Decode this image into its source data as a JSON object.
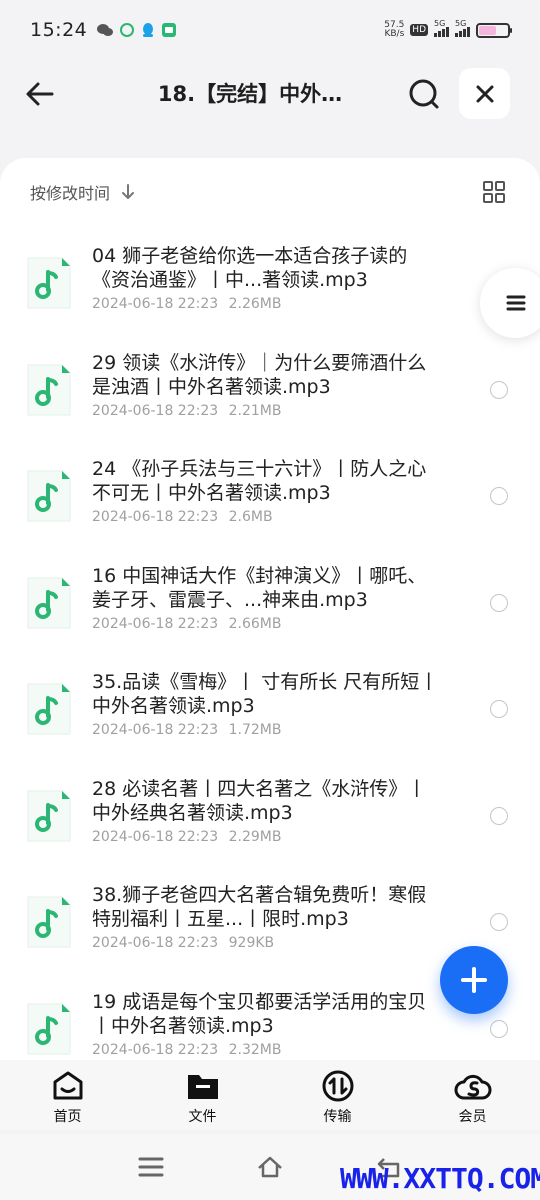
{
  "status_bar": {
    "time": "15:24",
    "net_speed_value": "57.5",
    "net_speed_unit": "KB/s",
    "hd_badge": "HD",
    "signal_1": "5G",
    "signal_2": "5G"
  },
  "header": {
    "title": "18.【完结】中外…"
  },
  "sort": {
    "label": "按修改时间"
  },
  "files": [
    {
      "name": "04 狮子老爸给你选一本适合孩子读的《资治通鉴》丨中...著领读.mp3",
      "date": "2024-06-18 22:23",
      "size": "2.26MB"
    },
    {
      "name": "29 领读《水浒传》｜为什么要筛酒什么是浊酒丨中外名著领读.mp3",
      "date": "2024-06-18 22:23",
      "size": "2.21MB"
    },
    {
      "name": "24 《孙子兵法与三十六计》丨防人之心不可无丨中外名著领读.mp3",
      "date": "2024-06-18 22:23",
      "size": "2.6MB"
    },
    {
      "name": "16 中国神话大作《封神演义》丨哪吒、姜子牙、雷震子、...神来由.mp3",
      "date": "2024-06-18 22:23",
      "size": "2.66MB"
    },
    {
      "name": "35.品读《雪梅》丨 寸有所长 尺有所短丨中外名著领读.mp3",
      "date": "2024-06-18 22:23",
      "size": "1.72MB"
    },
    {
      "name": "28 必读名著丨四大名著之《水浒传》丨中外经典名著领读.mp3",
      "date": "2024-06-18 22:23",
      "size": "2.29MB"
    },
    {
      "name": "38.狮子老爸四大名著合辑免费听！寒假特别福利丨五星...丨限时.mp3",
      "date": "2024-06-18 22:23",
      "size": "929KB"
    },
    {
      "name": "19 成语是每个宝贝都要活学活用的宝贝丨中外名著领读.mp3",
      "date": "2024-06-18 22:23",
      "size": "2.32MB"
    }
  ],
  "bottom_nav": [
    {
      "label": "首页",
      "icon": "home-icon"
    },
    {
      "label": "文件",
      "icon": "folder-icon"
    },
    {
      "label": "传输",
      "icon": "transfer-icon"
    },
    {
      "label": "会员",
      "icon": "vip-icon"
    }
  ],
  "watermark": "WWW.XXTTQ.COM",
  "colors": {
    "accent": "#1a6ef5",
    "file_icon": "#2bb673",
    "watermark": "#1822e8"
  }
}
